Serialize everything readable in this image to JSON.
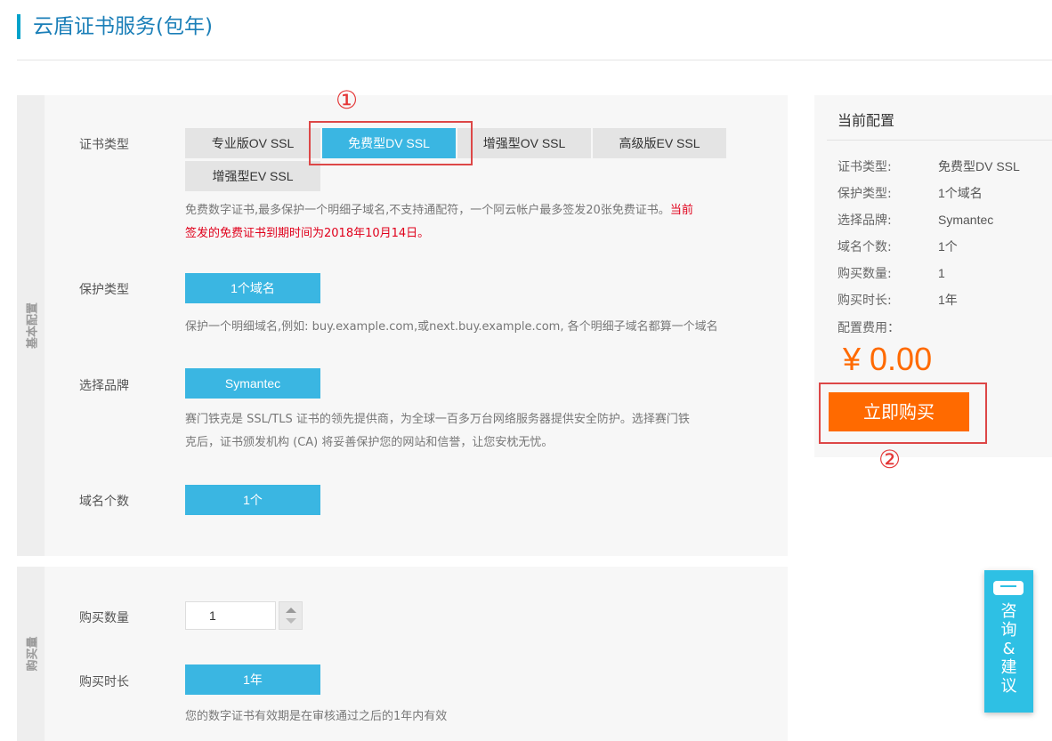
{
  "page": {
    "title": "云盾证书服务(包年)"
  },
  "basic_section": {
    "tab_label": "基本配置",
    "cert_type": {
      "label": "证书类型",
      "options": [
        "专业版OV SSL",
        "免费型DV SSL",
        "增强型OV SSL",
        "高级版EV SSL",
        "增强型EV SSL"
      ],
      "selected": "免费型DV SSL",
      "desc_normal": "免费数字证书,最多保护一个明细子域名,不支持通配符，一个阿云帐户最多签发20张免费证书。",
      "desc_red_1": "当前",
      "desc_red_2": "签发的免费证书到期时间为2018年10月14日。"
    },
    "protect_type": {
      "label": "保护类型",
      "option": "1个域名",
      "desc": "保护一个明细域名,例如: buy.example.com,或next.buy.example.com, 各个明细子域名都算一个域名"
    },
    "brand": {
      "label": "选择品牌",
      "option": "Symantec",
      "desc_1": "赛门铁克是 SSL/TLS 证书的领先提供商，为全球一百多万台网络服务器提供安全防护。选择赛门铁",
      "desc_2": "克后，证书颁发机构 (CA) 将妥善保护您的网站和信誉，让您安枕无忧。"
    },
    "domain_count": {
      "label": "域名个数",
      "option": "1个"
    }
  },
  "purchase_section": {
    "tab_label": "购买量",
    "quantity": {
      "label": "购买数量",
      "value": "1"
    },
    "duration": {
      "label": "购买时长",
      "option": "1年",
      "desc": "您的数字证书有效期是在审核通过之后的1年内有效"
    }
  },
  "summary": {
    "title": "当前配置",
    "rows": [
      {
        "k": "证书类型:",
        "v": "免费型DV SSL"
      },
      {
        "k": "保护类型:",
        "v": "1个域名"
      },
      {
        "k": "选择品牌:",
        "v": "Symantec"
      },
      {
        "k": "域名个数:",
        "v": "1个"
      },
      {
        "k": "购买数量:",
        "v": "1"
      },
      {
        "k": "购买时长:",
        "v": "1年"
      }
    ],
    "fee_label": "配置费用：",
    "price": "¥ 0.00",
    "buy_label": "立即购买"
  },
  "annotations": {
    "one": "①",
    "two": "②"
  },
  "consult": {
    "label": "咨\n询\n&\n建\n议"
  },
  "colors": {
    "accent": "#3ab6e2",
    "buy": "#ff6a00",
    "annotation": "#dd4747",
    "title_bar": "#00a2ca"
  }
}
